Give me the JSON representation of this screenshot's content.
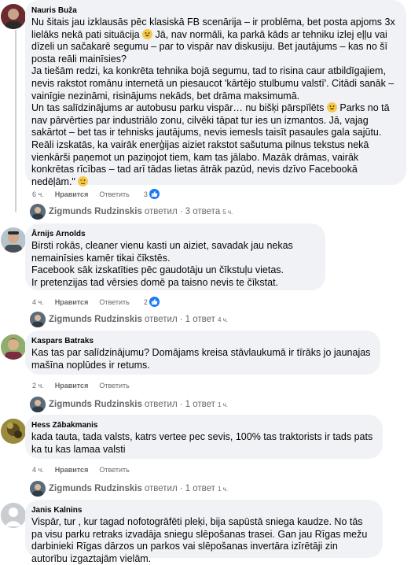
{
  "comments": [
    {
      "author": "Nauris Buža",
      "paragraphs": [
        "Nu šitais jau izklausās pēc klasiskā FB scenārija – ir problēma, bet posta apjoms 3x lielāks nekā pati situācija",
        "Jā, nav normāli, ka parkā kāds ar tehniku izlej eļļu vai dīzeli un sačakarē segumu – par to vispār nav diskusiju. Bet jautājums – kas no šī posta reāli mainīsies?",
        "Ja tiešām redzi, ka konkrēta tehnika bojā segumu, tad to risina caur atbildīgajiem, nevis rakstot romānu internetā un piesaucot 'kārtējo stulbumu valstī'. Citādi sanāk – vainīgie nezināmi, risinājums nekāds, bet drāma maksimumā.",
        "Un tas salīdzinājums ar autobusu parku vispār… nu bišķi pārspīlēts",
        "Parks no tā nav pārvērties par industriālo zonu, cilvēki tāpat tur ies un izmantos. Jā, vajag sakārtot – bet tas ir tehnisks jautājums, nevis iemesls taisīt pasaules gala sajūtu.",
        "Reāli izskatās, ka vairāk enerģijas aiziet rakstot sašutuma pilnus tekstus nekā vienkārši paņemot un paziņojot tiem, kam tas jālabo. Mazāk drāmas, vairāk konkrētas rīcības – tad arī tādas lietas ātrāk pazūd, nevis dzīvo Facebookā nedēļām.\""
      ],
      "time": "6 ч.",
      "like": "Нравится",
      "reply": "Ответить",
      "reactions": "3",
      "replies": {
        "author": "Zigmunds Rudzinskis",
        "verb": "ответил",
        "count": "· 3 ответа",
        "time": "5 ч."
      }
    },
    {
      "author": "Ārnijs Arnolds",
      "paragraphs": [
        "Birsti rokās, cleaner vienu kasti un aiziet, savadak jau nekas nemainīsies kamēr tikai čīkstēs.",
        "Facebook sāk izskatīties pēc gaudotāju un čīkstuļu vietas.",
        "Ir pretenzijas tad vērsies domē pa taisno nevis te čīkstat."
      ],
      "time": "4 ч.",
      "like": "Нравится",
      "reply": "Ответить",
      "reactions": "2",
      "replies": {
        "author": "Zigmunds Rudzinskis",
        "verb": "ответил",
        "count": "· 1 ответ",
        "time": "4 ч."
      }
    },
    {
      "author": "Kaspars Batraks",
      "paragraphs": [
        "Kas tas par salīdzinājumu? Domājams kreisa stāvlaukumā ir tīrāks jo jaunajas mašīna noplūdes ir retums."
      ],
      "time": "2 ч.",
      "like": "Нравится",
      "reply": "Ответить",
      "reactions": "",
      "replies": {
        "author": "Zigmunds Rudzinskis",
        "verb": "ответил",
        "count": "· 1 ответ",
        "time": "1 ч."
      }
    },
    {
      "author": "Hess Zābakmanis",
      "paragraphs": [
        "kada tauta, tada valsts, katrs vertee pec sevis, 100% tas traktorists ir tads pats ka tu kas lamaa valsti"
      ],
      "time": "4 ч.",
      "like": "Нравится",
      "reply": "Ответить",
      "reactions": "",
      "replies": {
        "author": "Zigmunds Rudzinskis",
        "verb": "ответил",
        "count": "· 1 ответ",
        "time": "1 ч."
      }
    },
    {
      "author": "Janis Kalnins",
      "paragraphs": [
        "Vispār, tur , kur tagad nofotogrāfēti pleķi, bija sapūstā sniega kaudze. No tās pa visu parku retraks izvadāja sniegu slēpošanas trasei. Gan jau Rīgas mežu darbinieki Rīgas dārzos un parkos vai slēpošanas invertāra izīrētāji zin autorību izgaztajām vielām."
      ]
    }
  ],
  "colors": {
    "like_blue": "#1877f2",
    "bubble": "#f0f2f5",
    "meta": "#65676b"
  },
  "icons": {
    "reaction": "thumbs-up-icon",
    "emoji": "grinning-face-icon",
    "wink": "winking-face-icon"
  }
}
